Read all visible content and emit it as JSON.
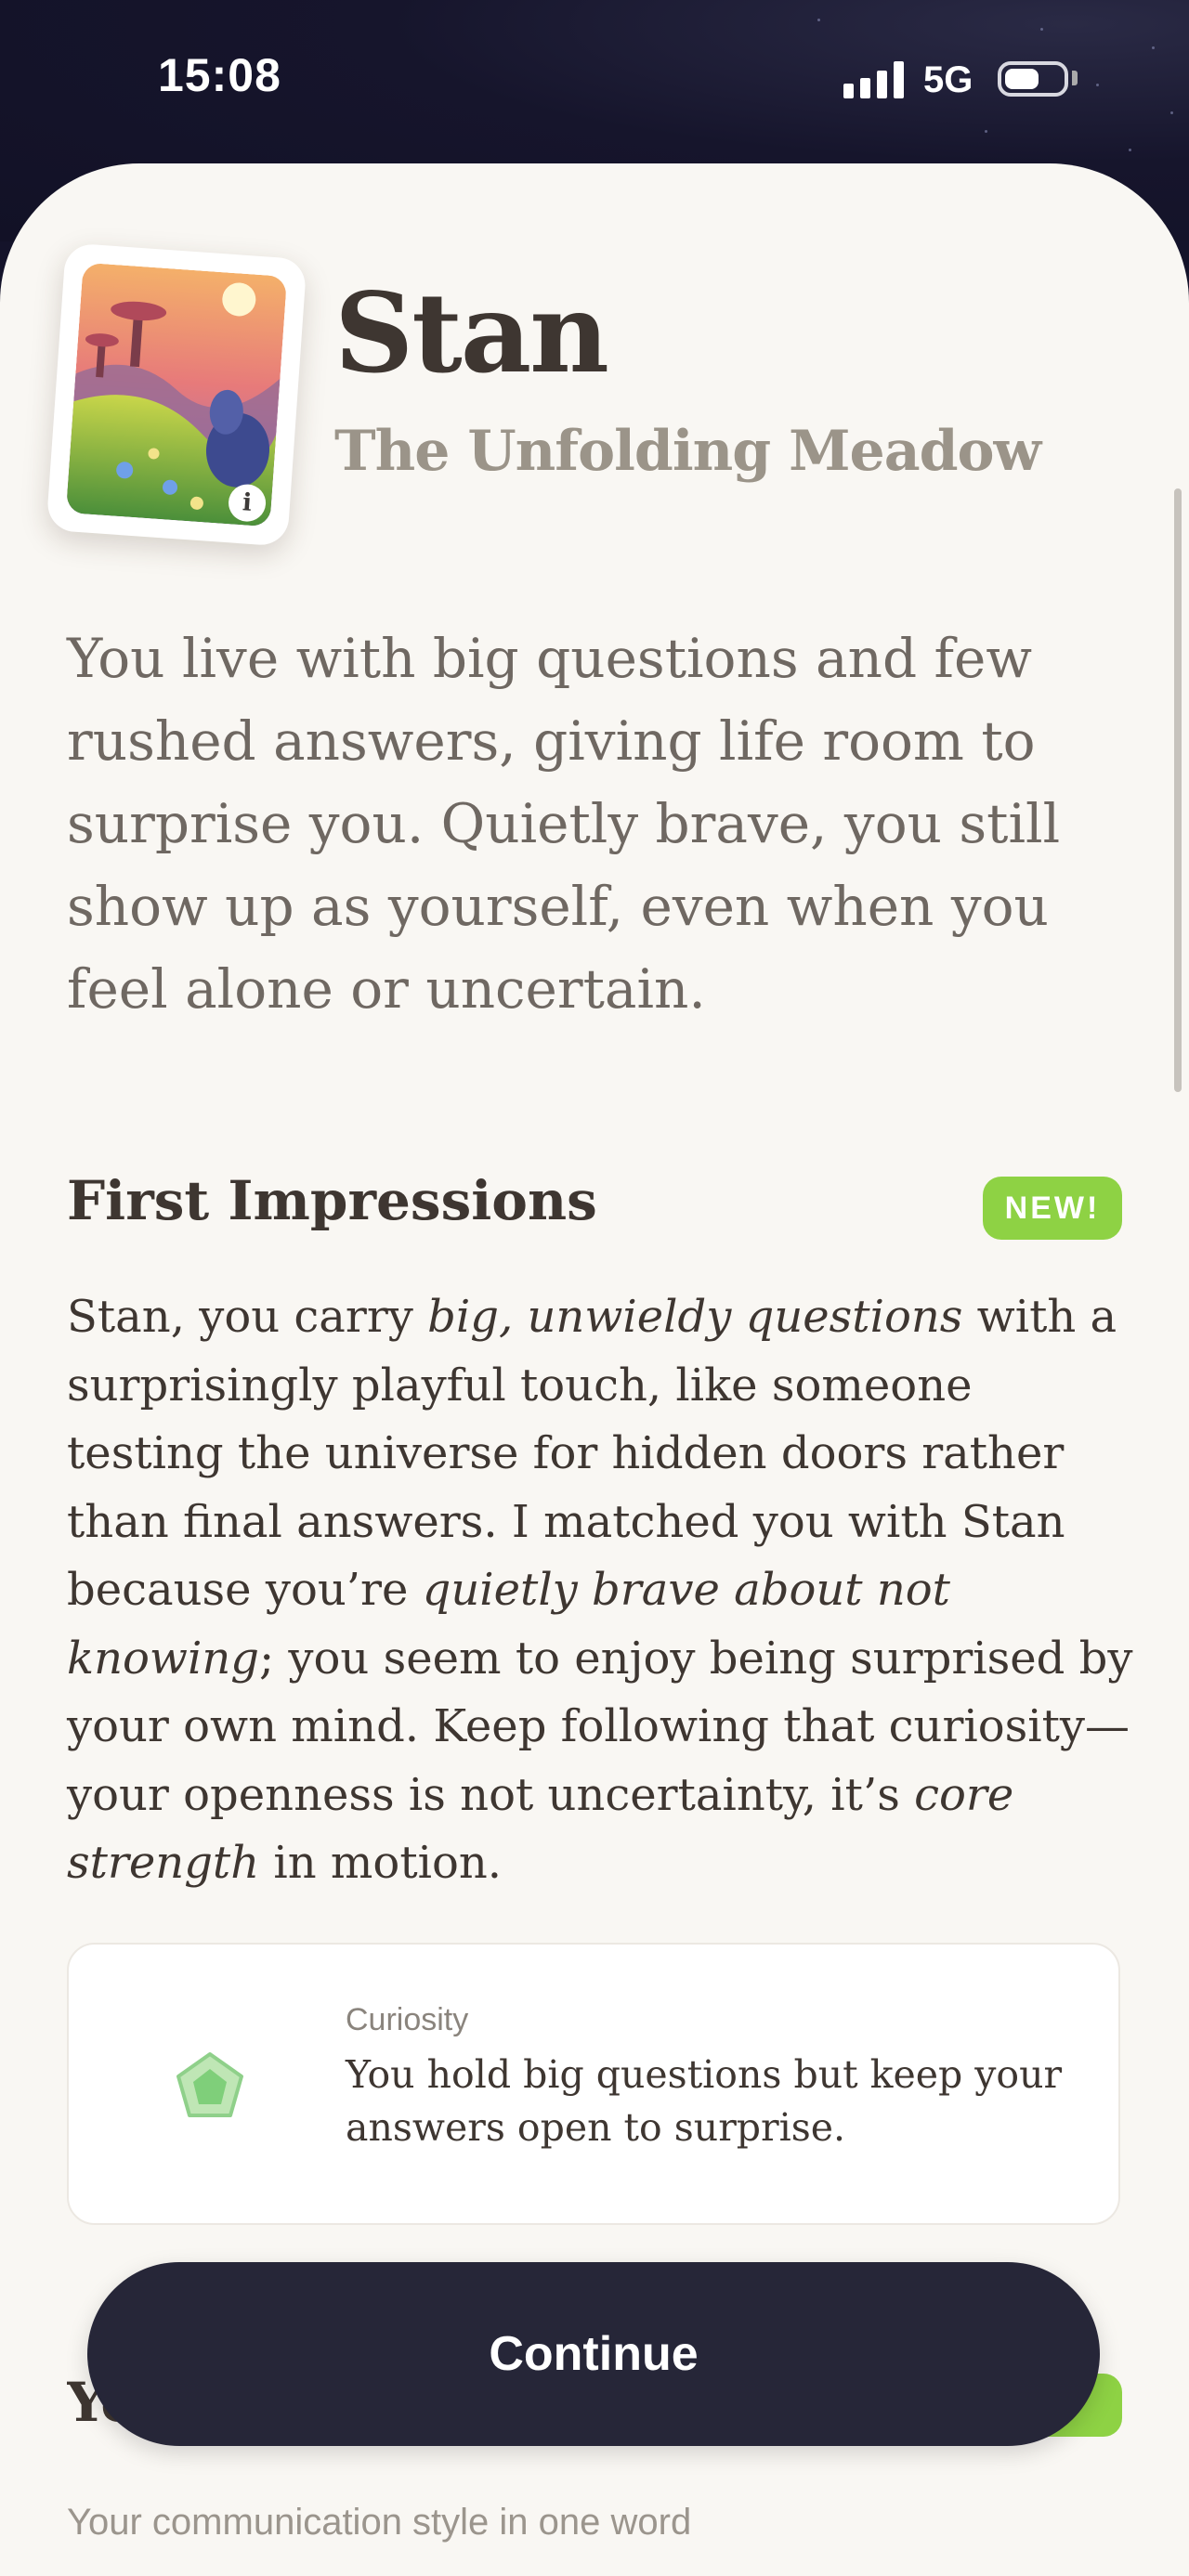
{
  "status_bar": {
    "time": "15:08",
    "network": "5G",
    "signal_icon": "signal-icon",
    "battery_icon": "battery-icon"
  },
  "profile": {
    "name": "Stan",
    "subtitle": "The Unfolding Meadow",
    "card_art_icon": "meadow-card-image",
    "info_label": "i",
    "intro": "You live with big questions and few rushed answers, giving life room to surprise you. Quietly brave, you still show up as yourself, even when you feel alone or uncertain."
  },
  "first_impressions": {
    "title": "First Impressions",
    "badge": "NEW!",
    "text_parts": {
      "p1": "Stan, you carry ",
      "p2": "big, unwieldy questions",
      "p3": " with a surprisingly playful touch, like someone testing the universe for hidden doors rather than final answers. I matched you with Stan because you’re ",
      "p4": "quietly brave about not knowing",
      "p5": "; you seem to enjoy being surprised by your own mind. Keep following that curiosity—your openness is not uncertainty, it’s ",
      "p6": "core strength",
      "p7": " in motion."
    }
  },
  "trait_card": {
    "icon": "pentagon-flower-icon",
    "label": "Curiosity",
    "text": "You hold big questions but keep your answers open to surprise."
  },
  "next_section": {
    "heading": "Yo",
    "caption": "Your communication style in one word"
  },
  "continue_button": {
    "label": "Continue"
  },
  "colors": {
    "accent_green": "#8ed244",
    "button_dark": "#262638",
    "sheet_bg": "#f9f7f3",
    "heading": "#3e3631"
  }
}
